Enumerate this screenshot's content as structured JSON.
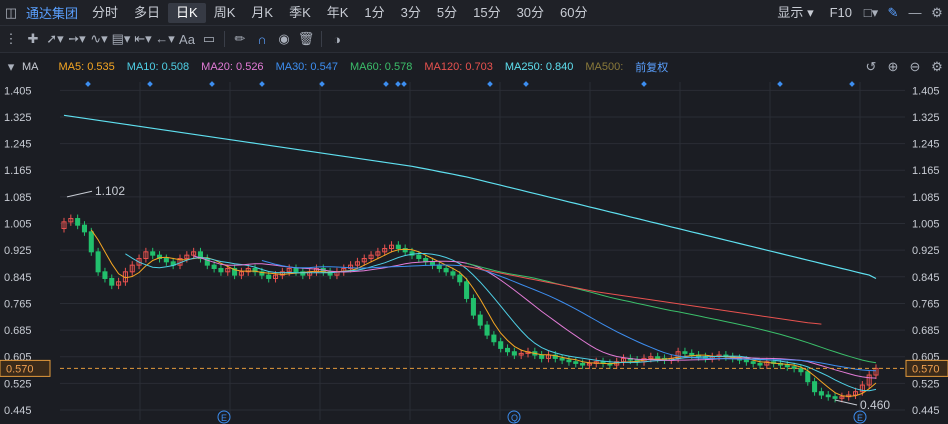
{
  "nav": {
    "stock_name": "通达集团",
    "periods": [
      "分时",
      "多日",
      "日K",
      "周K",
      "月K",
      "季K",
      "年K",
      "1分",
      "3分",
      "5分",
      "15分",
      "30分",
      "60分"
    ],
    "active_period": "日K",
    "display_label": "显示",
    "f10_label": "F10"
  },
  "tools": {
    "icons": [
      "window-icon",
      "crosshair-icon",
      "line-draw-icon",
      "ray-tool-icon",
      "wave-tool-icon",
      "range-tool-icon",
      "undo-arrow-icon",
      "text-tool-icon",
      "comment-icon",
      "eraser-pen-icon",
      "magnet-icon",
      "eye-icon",
      "trash-icon",
      "toggle-icon"
    ],
    "text_tool_label": "Aa"
  },
  "ma_bar": {
    "indicator": "MA",
    "items": [
      {
        "label": "MA5:",
        "value": "0.535",
        "color": "#f5a623"
      },
      {
        "label": "MA10:",
        "value": "0.508",
        "color": "#4fd0e6"
      },
      {
        "label": "MA20:",
        "value": "0.526",
        "color": "#e27bd6"
      },
      {
        "label": "MA30:",
        "value": "0.547",
        "color": "#3d8ef0"
      },
      {
        "label": "MA60:",
        "value": "0.578",
        "color": "#3bbf6a"
      },
      {
        "label": "MA120:",
        "value": "0.703",
        "color": "#e8524f"
      },
      {
        "label": "MA250:",
        "value": "0.840",
        "color": "#5fe0f0"
      },
      {
        "label": "MA500:",
        "value": "",
        "color": "#8a7a3a"
      }
    ],
    "adjust_label": "前复权"
  },
  "chart_data": {
    "type": "line",
    "y_ticks": [
      "1.405",
      "1.325",
      "1.245",
      "1.165",
      "1.085",
      "1.005",
      "0.925",
      "0.845",
      "0.765",
      "0.685",
      "0.605",
      "0.525",
      "0.445"
    ],
    "ylim": [
      0.415,
      1.43
    ],
    "current_price": "0.570",
    "max_annotation": "1.102",
    "min_annotation": "0.460",
    "grid": true,
    "colors": {
      "up": "#e8524f",
      "down": "#22c06d",
      "bg": "#1b1d23",
      "grid": "#2a2d35"
    },
    "event_markers": [
      "E",
      "Q",
      "E"
    ],
    "close": [
      1.01,
      1.02,
      1.0,
      0.98,
      0.92,
      0.86,
      0.84,
      0.82,
      0.83,
      0.86,
      0.88,
      0.9,
      0.92,
      0.91,
      0.9,
      0.89,
      0.88,
      0.9,
      0.91,
      0.92,
      0.9,
      0.88,
      0.87,
      0.86,
      0.87,
      0.85,
      0.86,
      0.87,
      0.86,
      0.85,
      0.84,
      0.85,
      0.86,
      0.87,
      0.86,
      0.85,
      0.86,
      0.87,
      0.86,
      0.85,
      0.86,
      0.87,
      0.88,
      0.89,
      0.9,
      0.91,
      0.92,
      0.93,
      0.94,
      0.93,
      0.92,
      0.91,
      0.9,
      0.89,
      0.88,
      0.87,
      0.86,
      0.85,
      0.83,
      0.78,
      0.73,
      0.7,
      0.67,
      0.65,
      0.63,
      0.62,
      0.61,
      0.615,
      0.62,
      0.61,
      0.6,
      0.61,
      0.6,
      0.595,
      0.59,
      0.585,
      0.58,
      0.585,
      0.59,
      0.585,
      0.58,
      0.59,
      0.6,
      0.595,
      0.59,
      0.6,
      0.605,
      0.6,
      0.595,
      0.6,
      0.62,
      0.615,
      0.61,
      0.605,
      0.6,
      0.605,
      0.61,
      0.605,
      0.6,
      0.595,
      0.59,
      0.585,
      0.58,
      0.59,
      0.585,
      0.58,
      0.575,
      0.57,
      0.56,
      0.53,
      0.5,
      0.49,
      0.485,
      0.48,
      0.485,
      0.49,
      0.5,
      0.52,
      0.55,
      0.57
    ],
    "ma250": [
      1.33,
      1.327,
      1.324,
      1.321,
      1.318,
      1.315,
      1.312,
      1.309,
      1.306,
      1.303,
      1.3,
      1.297,
      1.294,
      1.291,
      1.288,
      1.285,
      1.282,
      1.279,
      1.276,
      1.273,
      1.27,
      1.267,
      1.264,
      1.261,
      1.258,
      1.255,
      1.252,
      1.249,
      1.246,
      1.243,
      1.24,
      1.237,
      1.234,
      1.231,
      1.228,
      1.225,
      1.222,
      1.219,
      1.216,
      1.213,
      1.21,
      1.207,
      1.204,
      1.201,
      1.198,
      1.195,
      1.192,
      1.189,
      1.186,
      1.183,
      1.18,
      1.177,
      1.173,
      1.169,
      1.165,
      1.161,
      1.157,
      1.153,
      1.149,
      1.145,
      1.14,
      1.135,
      1.13,
      1.125,
      1.12,
      1.115,
      1.11,
      1.105,
      1.1,
      1.095,
      1.09,
      1.085,
      1.08,
      1.075,
      1.07,
      1.065,
      1.06,
      1.055,
      1.05,
      1.045,
      1.04,
      1.035,
      1.03,
      1.025,
      1.02,
      1.015,
      1.01,
      1.005,
      1.0,
      0.995,
      0.99,
      0.985,
      0.98,
      0.975,
      0.97,
      0.965,
      0.96,
      0.955,
      0.95,
      0.945,
      0.94,
      0.935,
      0.93,
      0.925,
      0.92,
      0.915,
      0.91,
      0.905,
      0.9,
      0.895,
      0.89,
      0.885,
      0.88,
      0.875,
      0.87,
      0.865,
      0.86,
      0.855,
      0.85,
      0.84
    ],
    "ma120": [
      null,
      null,
      null,
      null,
      null,
      null,
      null,
      null,
      null,
      null,
      null,
      null,
      null,
      null,
      null,
      null,
      null,
      null,
      null,
      null,
      null,
      null,
      null,
      null,
      null,
      null,
      null,
      null,
      null,
      null,
      null,
      null,
      null,
      null,
      null,
      null,
      null,
      null,
      null,
      null,
      null,
      null,
      null,
      null,
      null,
      null,
      null,
      null,
      null,
      null,
      null,
      null,
      null,
      null,
      null,
      null,
      null,
      null,
      0.88,
      0.876,
      0.872,
      0.868,
      0.864,
      0.86,
      0.856,
      0.852,
      0.848,
      0.844,
      0.84,
      0.836,
      0.832,
      0.828,
      0.824,
      0.82,
      0.816,
      0.812,
      0.808,
      0.804,
      0.8,
      0.797,
      0.794,
      0.791,
      0.788,
      0.785,
      0.782,
      0.779,
      0.776,
      0.773,
      0.77,
      0.767,
      0.764,
      0.761,
      0.758,
      0.755,
      0.752,
      0.749,
      0.746,
      0.743,
      0.74,
      0.737,
      0.734,
      0.731,
      0.728,
      0.725,
      0.722,
      0.719,
      0.716,
      0.713,
      0.71,
      0.707,
      0.705,
      0.703
    ]
  }
}
